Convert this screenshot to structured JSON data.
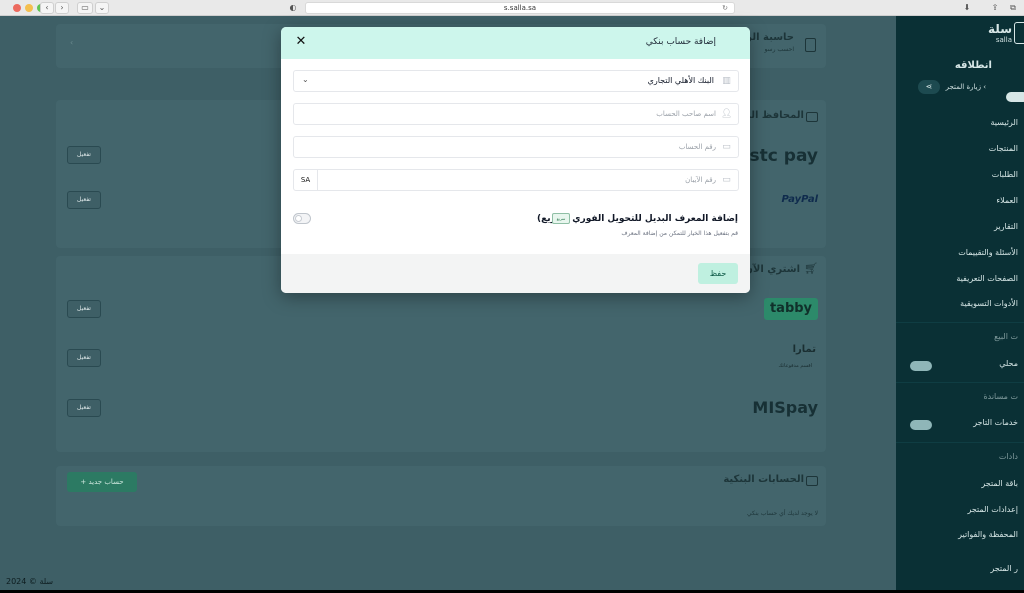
{
  "browser": {
    "url": "s.salla.sa"
  },
  "sidebar": {
    "brand": "سلة",
    "brand_sub": "salla",
    "store_name": "انطلاقه",
    "visit_store": "زيارة المتجر",
    "items": [
      {
        "label": "الرئيسية"
      },
      {
        "label": "المنتجات"
      },
      {
        "label": "الطلبات"
      },
      {
        "label": "العملاء"
      },
      {
        "label": "التقارير"
      },
      {
        "label": "الأسئلة والتقييمات"
      },
      {
        "label": "الصفحات التعريفية"
      },
      {
        "label": "الأدوات التسويقية"
      }
    ],
    "sec_sales": "ت البيع",
    "mahlli": "محلي",
    "sec_support": "ت مساندة",
    "merchant_services": "خدمات التاجر",
    "sec_settings": "دادات",
    "store_package": "باقة المتجر",
    "store_settings": "إعدادات المتجر",
    "wallet": "المحفظة والفواتير",
    "store_team": "ر المتجر"
  },
  "page": {
    "receiving_title": "حاسبة الرسو",
    "receiving_sub": "احسب رسو",
    "wallets_title": "المحافظ الرقم",
    "bnpl_title": "اشتري الآن وا",
    "bank_title": "الحسابات البنكية",
    "bank_empty": "لا يوجد لديك أي حساب بنكي",
    "new_account": "حساب جديد",
    "activate_label": "تفعيل",
    "logos": {
      "stcpay": "stc pay",
      "paypal": "PayPal",
      "tabby": "tabby",
      "tamara": "تمارا",
      "tamara_sub": "اقسم مدفوعاتك",
      "mispay": "MISpay"
    },
    "footer": "سلة © 2024"
  },
  "modal": {
    "title": "إضافة حساب بنكي",
    "bank_value": "البنك الأهلي التجاري",
    "holder_placeholder": "اسم صاحب الحساب",
    "account_placeholder": "رقم الحساب",
    "iban_placeholder": "رقم الآيبان",
    "iban_prefix": "SA",
    "alt_title": "إضافة المعرف البديل للتحويل الفوري (سريع)",
    "alt_badge": "سريع",
    "alt_desc": "قم بتفعيل هذا الخيار للتمكن من إضافة المعرف",
    "save": "حفظ",
    "toggle_on": false
  },
  "colors": {
    "modal_header": "#cdf6ec",
    "save_button": "#bff0e0",
    "sidebar": "#0a3035",
    "overlay_page": "#3e5f66"
  }
}
